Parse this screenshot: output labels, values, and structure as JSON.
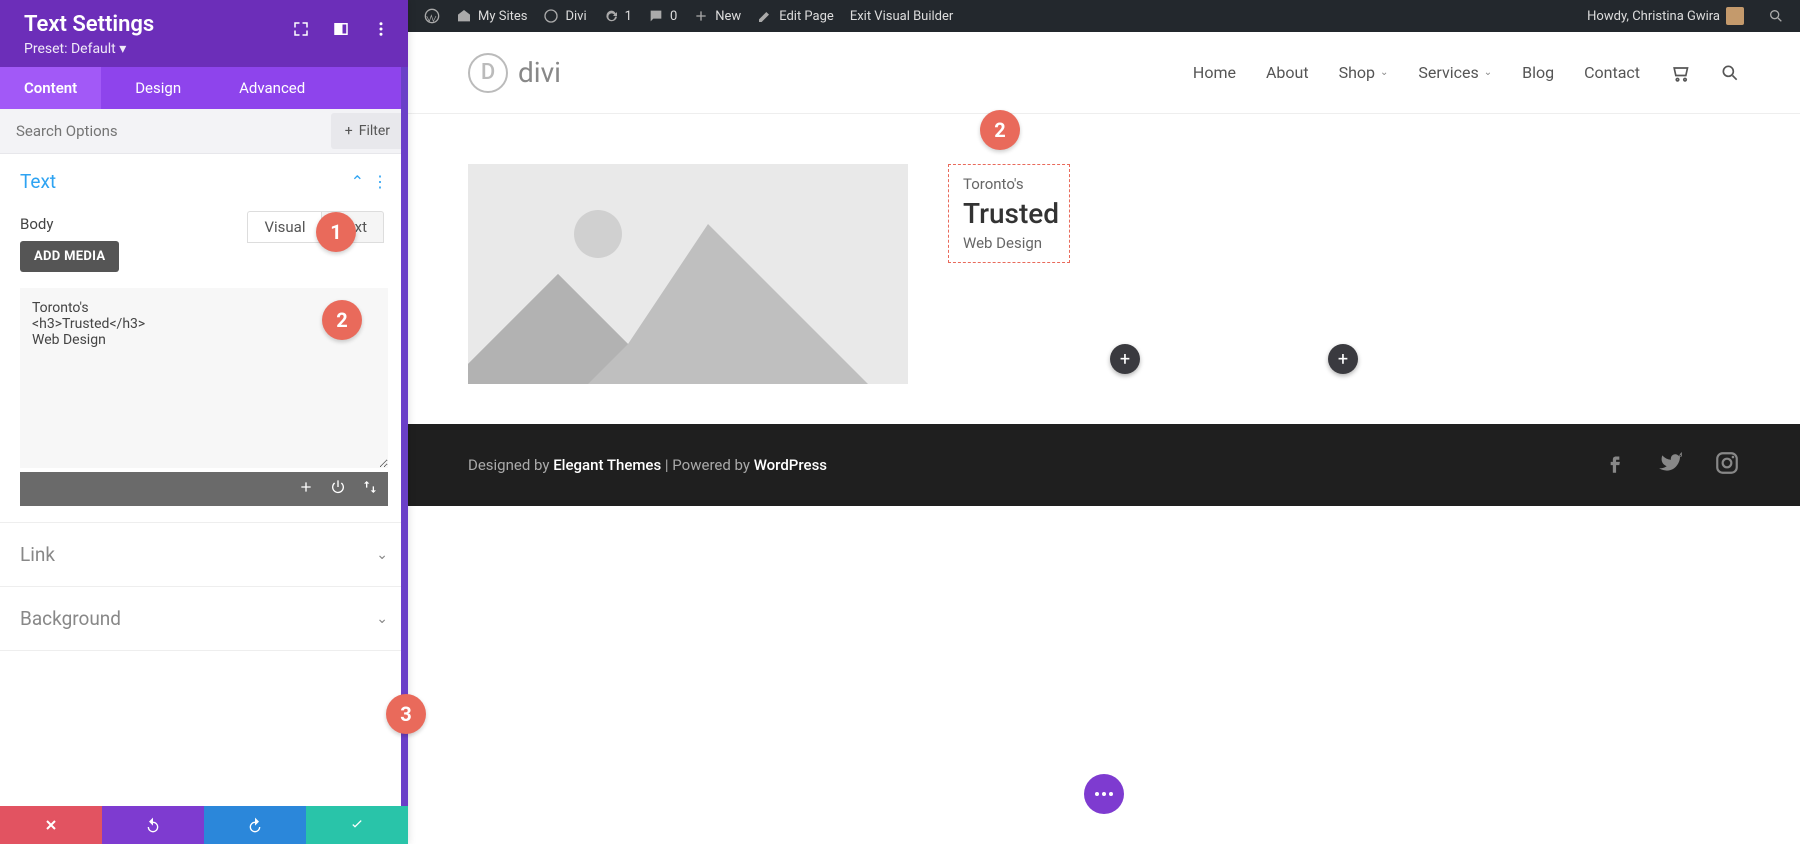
{
  "panel": {
    "title": "Text Settings",
    "preset": "Preset: Default ▾",
    "tabs": {
      "content": "Content",
      "design": "Design",
      "advanced": "Advanced"
    },
    "search_placeholder": "Search Options",
    "filter": "Filter",
    "section_text": "Text",
    "body_label": "Body",
    "add_media": "ADD MEDIA",
    "editor_tabs": {
      "visual": "Visual",
      "text": "Text"
    },
    "editor_content": "Toronto's\n<h3>Trusted</h3>\nWeb Design",
    "section_link": "Link",
    "section_background": "Background"
  },
  "badges": {
    "one": "1",
    "two": "2",
    "three": "3"
  },
  "adminbar": {
    "my_sites": "My Sites",
    "divi": "Divi",
    "updates": "1",
    "comments": "0",
    "new": "New",
    "edit_page": "Edit Page",
    "exit_vb": "Exit Visual Builder",
    "howdy": "Howdy, Christina Gwira"
  },
  "site": {
    "logo_text": "divi",
    "nav": {
      "home": "Home",
      "about": "About",
      "shop": "Shop",
      "services": "Services",
      "blog": "Blog",
      "contact": "Contact"
    }
  },
  "module": {
    "line1": "Toronto's",
    "line2": "Trusted",
    "line3": "Web Design"
  },
  "footer": {
    "designed_by": "Designed by ",
    "et": "Elegant Themes",
    "sep": " | ",
    "powered_by": "Powered by ",
    "wp": "WordPress"
  }
}
